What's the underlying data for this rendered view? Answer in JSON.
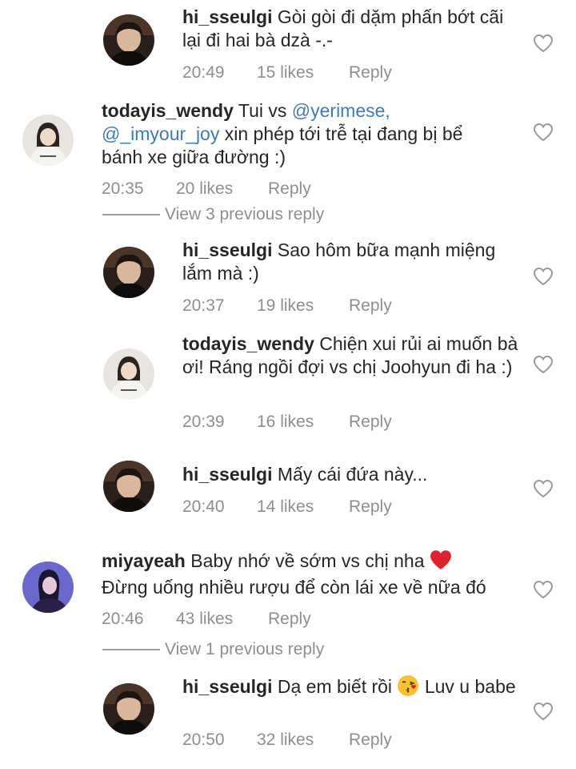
{
  "comments": [
    {
      "username": "hi_sseulgi",
      "text": "Gòi gòi đi dặm phấn bớt cãi lại đi hai bà dzà -.-",
      "time": "20:49",
      "likes": "15 likes",
      "reply": "Reply"
    },
    {
      "username": "todayis_wendy",
      "text_before": "Tui vs ",
      "mention1": "@yerimese,",
      "mention2": "@_imyour_joy",
      "text_after": " xin phép tới trễ tại đang bị bể bánh xe giữa đường :)",
      "time": "20:35",
      "likes": "20 likes",
      "reply": "Reply"
    },
    {
      "username": "hi_sseulgi",
      "text": "Sao hôm bữa mạnh miệng lắm mà :)",
      "time": "20:37",
      "likes": "19 likes",
      "reply": "Reply"
    },
    {
      "username": "todayis_wendy",
      "text": "Chiện xui rủi ai muốn bà ơi! Ráng ngồi đợi vs chị Joohyun đi ha :)",
      "time": "20:39",
      "likes": "16 likes",
      "reply": "Reply"
    },
    {
      "username": "hi_sseulgi",
      "text": "Mấy cái đứa này...",
      "time": "20:40",
      "likes": "14 likes",
      "reply": "Reply"
    },
    {
      "username": "miyayeah",
      "text_before": "Baby nhớ về sớm vs chị nha ",
      "text_after": "Đừng uống nhiều rượu để còn lái xe về nữa đó",
      "time": "20:46",
      "likes": "43 likes",
      "reply": "Reply"
    },
    {
      "username": "hi_sseulgi",
      "text_before": "Dạ em biết rồi ",
      "text_after": " Luv u babe",
      "time": "20:50",
      "likes": "32 likes",
      "reply": "Reply"
    }
  ],
  "view_replies": [
    "View 3 previous reply",
    "View 1 previous reply"
  ],
  "icons": {
    "like": "heart-outline-icon",
    "red_heart": "red-heart-emoji",
    "kiss": "kissing-face-emoji"
  },
  "colors": {
    "mention": "#3c7bbd",
    "meta": "#8e8e8e",
    "text": "#262626"
  }
}
